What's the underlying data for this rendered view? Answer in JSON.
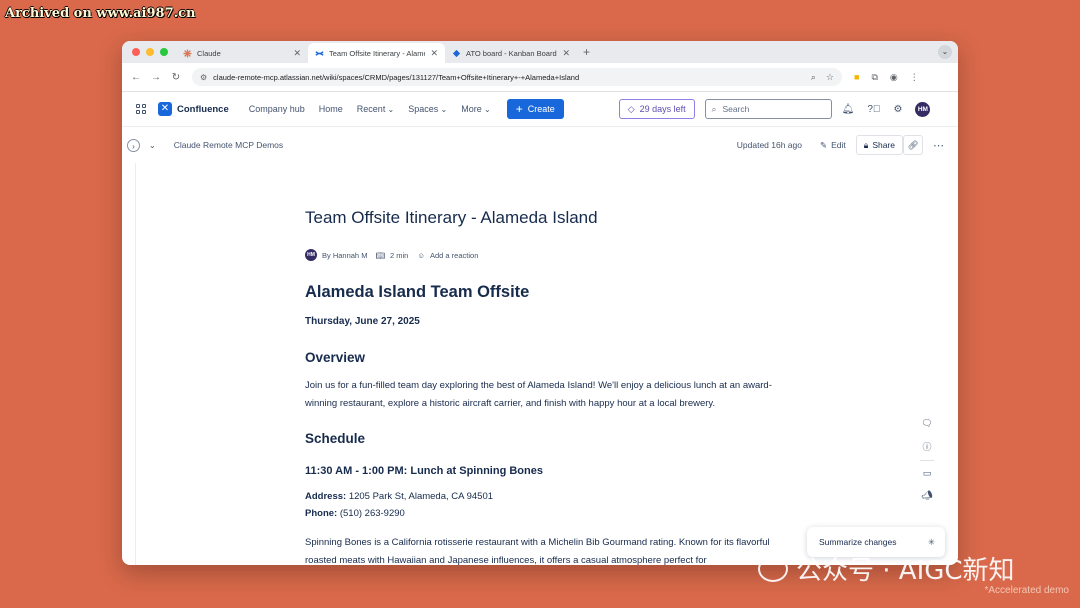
{
  "watermarks": {
    "top_left": "Archived on www.ai987.cn",
    "bottom_right": "公众号 · AIGC新知",
    "accel_note": "*Accelerated demo"
  },
  "browser": {
    "tabs": [
      {
        "title": "Claude",
        "icon": "claude-icon",
        "active": false
      },
      {
        "title": "Team Offsite Itinerary - Alameda",
        "icon": "confluence-icon",
        "active": true
      },
      {
        "title": "ATO board - Kanban Board -",
        "icon": "jira-icon",
        "active": false
      }
    ],
    "new_tab": "+",
    "url": "claude-remote-mcp.atlassian.net/wiki/spaces/CRMD/pages/131127/Team+Offsite+Itinerary+-+Alameda+Island"
  },
  "header": {
    "product": "Confluence",
    "nav": [
      "Company hub",
      "Home",
      "Recent",
      "Spaces",
      "More"
    ],
    "create_label": "Create",
    "trial_label": "29 days left",
    "search_placeholder": "Search",
    "avatar_initials": "HM"
  },
  "toolbar": {
    "breadcrumb": "Claude Remote MCP Demos",
    "updated": "Updated 16h ago",
    "edit_label": "Edit",
    "share_label": "Share"
  },
  "page": {
    "title": "Team Offsite Itinerary - Alameda Island",
    "byline": {
      "initials": "HM",
      "author": "By Hannah M",
      "read_time": "2 min",
      "reaction": "Add a reaction"
    },
    "heading": "Alameda Island Team Offsite",
    "date": "Thursday, June 27, 2025",
    "overview_heading": "Overview",
    "overview_text": "Join us for a fun-filled team day exploring the best of Alameda Island! We'll enjoy a delicious lunch at an award-winning restaurant, explore a historic aircraft carrier, and finish with happy hour at a local brewery.",
    "schedule_heading": "Schedule",
    "lunch_heading": "11:30 AM - 1:00 PM: Lunch at Spinning Bones",
    "address_label": "Address:",
    "address_value": " 1205 Park St, Alameda, CA 94501",
    "phone_label": "Phone:",
    "phone_value": " (510) 263-9290",
    "lunch_text": "Spinning Bones is a California rotisserie restaurant with a Michelin Bib Gourmand rating. Known for its flavorful roasted meats with Hawaiian and Japanese influences, it offers a casual atmosphere perfect for"
  },
  "summarize_label": "Summarize changes",
  "colors": {
    "accent": "#1868db",
    "trial": "#5e4db2",
    "background": "#d9694a"
  }
}
